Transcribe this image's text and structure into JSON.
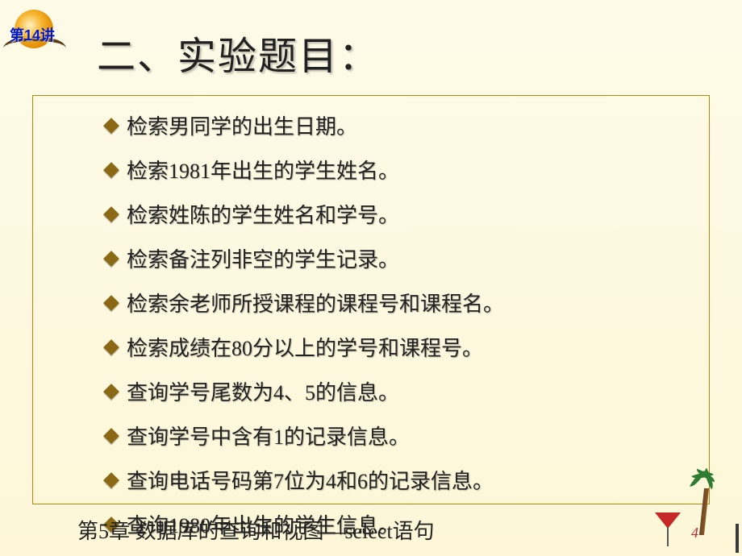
{
  "badge": {
    "label": "第14讲"
  },
  "title": "二、实验题目：",
  "items": [
    "检索男同学的出生日期。",
    "检索1981年出生的学生姓名。",
    "检索姓陈的学生姓名和学号。",
    "检索备注列非空的学生记录。",
    "检索余老师所授课程的课程号和课程名。",
    "检索成绩在80分以上的学号和课程号。",
    "查询学号尾数为4、5的信息。",
    "查询学号中含有1的记录信息。",
    "查询电话号码第7位为4和6的记录信息。",
    "查询1980年出生的学生信息。"
  ],
  "footer": "第5章    数据库的查询和视图—select语句",
  "pageNumber": "4"
}
